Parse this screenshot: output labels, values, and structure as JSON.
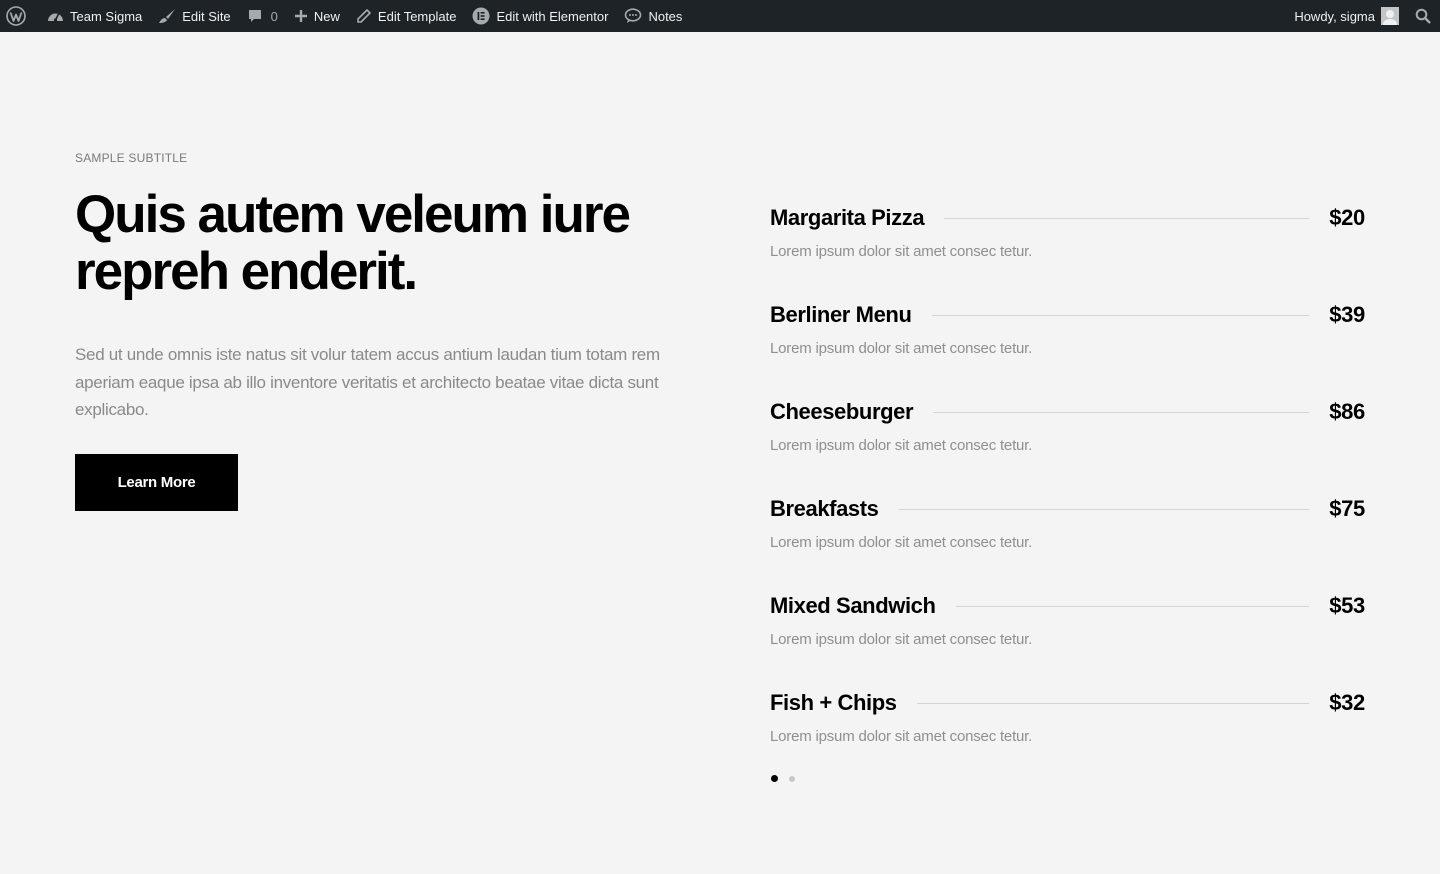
{
  "adminbar": {
    "site_name": "Team Sigma",
    "edit_site": "Edit Site",
    "comments_count": "0",
    "new_label": "New",
    "edit_template": "Edit Template",
    "edit_elementor": "Edit with Elementor",
    "notes": "Notes",
    "howdy": "Howdy, sigma"
  },
  "hero": {
    "subtitle": "SAMPLE SUBTITLE",
    "title_line1": "Quis autem veleum iure",
    "title_line2": "repreh enderit.",
    "lead": "Sed ut unde omnis iste natus sit volur tatem accus antium laudan tium totam rem aperiam eaque ipsa ab illo inventore veritatis et architecto beatae vitae dicta sunt explicabo.",
    "button_label": "Learn More"
  },
  "menu": {
    "items": [
      {
        "name": "Margarita Pizza",
        "price": "$20",
        "desc": "Lorem ipsum dolor sit amet consec tetur."
      },
      {
        "name": "Berliner Menu",
        "price": "$39",
        "desc": "Lorem ipsum dolor sit amet consec tetur."
      },
      {
        "name": "Cheeseburger",
        "price": "$86",
        "desc": "Lorem ipsum dolor sit amet consec tetur."
      },
      {
        "name": "Breakfasts",
        "price": "$75",
        "desc": "Lorem ipsum dolor sit amet consec tetur."
      },
      {
        "name": "Mixed Sandwich",
        "price": "$53",
        "desc": "Lorem ipsum dolor sit amet consec tetur."
      },
      {
        "name": "Fish + Chips",
        "price": "$32",
        "desc": "Lorem ipsum dolor sit amet consec tetur."
      }
    ]
  },
  "pagination": {
    "current_page": 1,
    "total_pages": 2
  },
  "colors": {
    "adminbar_bg": "#1d2327",
    "page_bg": "#f4f4f4",
    "button_bg": "#000000",
    "muted_text": "#8a8a8a"
  }
}
